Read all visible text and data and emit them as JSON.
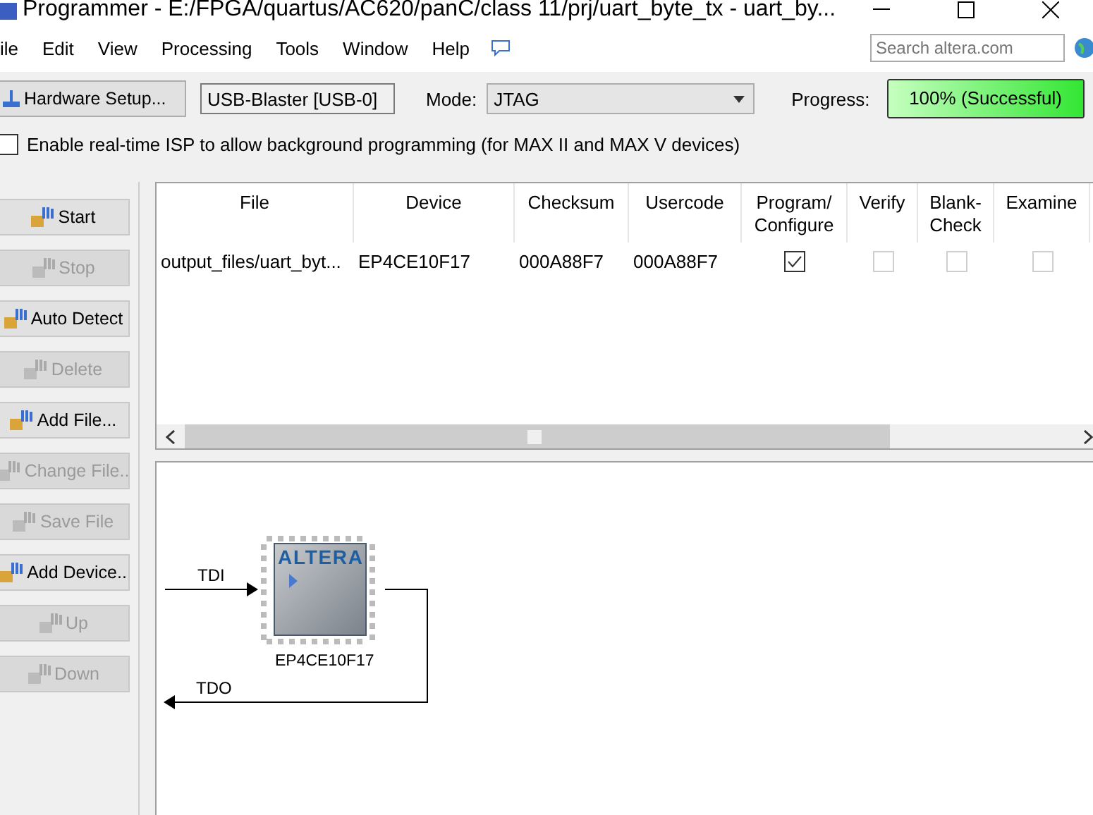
{
  "window": {
    "title": "Programmer - E:/FPGA/quartus/AC620/panC/class 11/prj/uart_byte_tx - uart_by..."
  },
  "menu": [
    "ile",
    "Edit",
    "View",
    "Processing",
    "Tools",
    "Window",
    "Help"
  ],
  "search": {
    "placeholder": "Search altera.com"
  },
  "toolbar": {
    "hardware_button": "Hardware Setup...",
    "hardware": "USB-Blaster [USB-0]",
    "mode_label": "Mode:",
    "mode": "JTAG",
    "progress_label": "Progress:",
    "progress_text": "100% (Successful)",
    "level": 1
  },
  "isp": {
    "label": "Enable real-time ISP to allow background programming (for MAX II and MAX V devices)",
    "checked": false
  },
  "actions": [
    {
      "label": "Start",
      "disabled": false
    },
    {
      "label": "Stop",
      "disabled": true
    },
    {
      "label": "Auto Detect",
      "disabled": false
    },
    {
      "label": "Delete",
      "disabled": true
    },
    {
      "label": "Add File...",
      "disabled": false
    },
    {
      "label": "Change File..",
      "disabled": true
    },
    {
      "label": "Save File",
      "disabled": true
    },
    {
      "label": "Add Device..",
      "disabled": false
    },
    {
      "label": "Up",
      "disabled": true
    },
    {
      "label": "Down",
      "disabled": true
    }
  ],
  "table": {
    "columns": [
      "File",
      "Device",
      "Checksum",
      "Usercode",
      "Program/ Configure",
      "Verify",
      "Blank- Check",
      "Examine"
    ],
    "rows": [
      {
        "file": "output_files/uart_byt...",
        "device": "EP4CE10F17",
        "checksum": "000A88F7",
        "usercode": "000A88F7",
        "program": true,
        "verify": false,
        "blank_check": false,
        "examine": false
      }
    ]
  },
  "chain": {
    "tdi": "TDI",
    "tdo": "TDO",
    "logo": "ALTERA",
    "device": "EP4CE10F17"
  }
}
